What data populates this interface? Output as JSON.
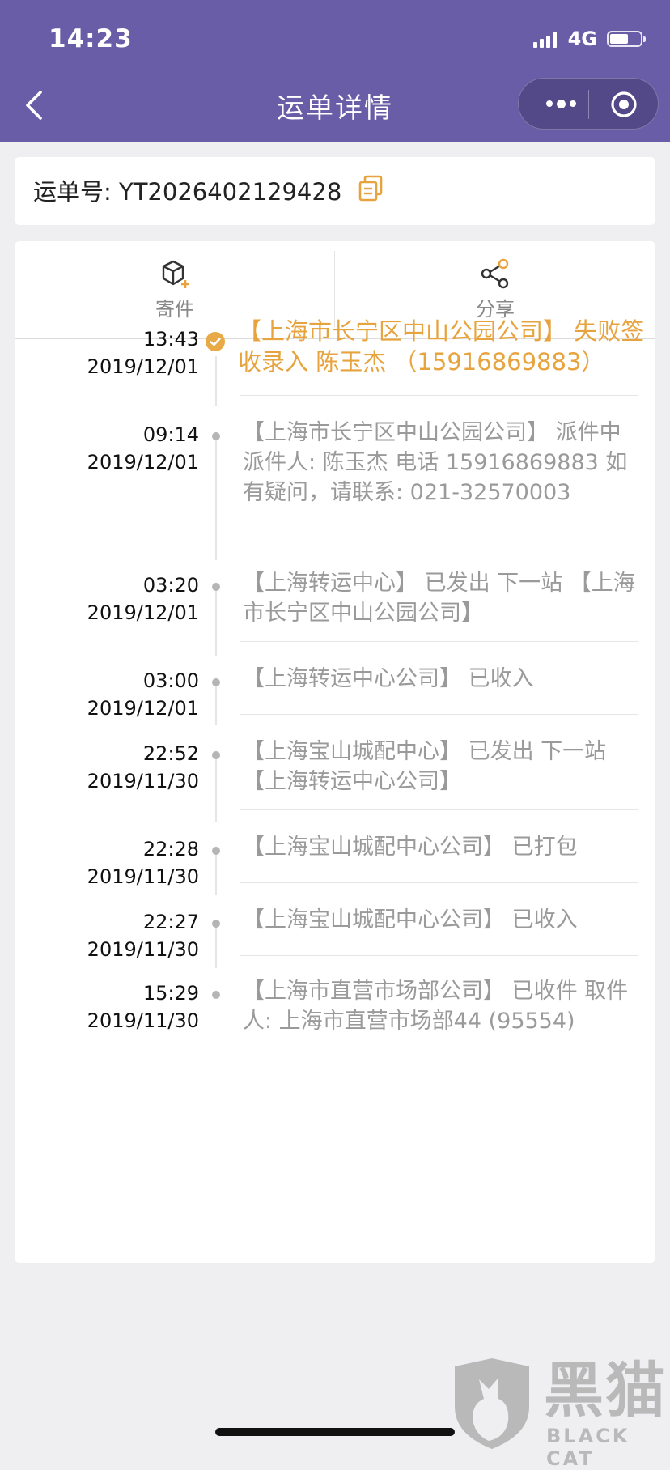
{
  "status_bar": {
    "time": "14:23",
    "network": "4G"
  },
  "nav": {
    "title": "运单详情"
  },
  "waybill": {
    "label": "运单号: YT2026402129428"
  },
  "actions": [
    {
      "label": "寄件",
      "icon": "package-add-icon"
    },
    {
      "label": "分享",
      "icon": "share-icon"
    }
  ],
  "timeline": [
    {
      "time": "13:43",
      "date": "2019/12/01",
      "text": "【上海市长宁区中山公园公司】 失败签收录入 陈玉杰 （15916869883）",
      "active": true
    },
    {
      "time": "09:14",
      "date": "2019/12/01",
      "text": "【上海市长宁区中山公园公司】 派件中 派件人: 陈玉杰 电话 15916869883 如有疑问，请联系: 021-32570003",
      "active": false
    },
    {
      "time": "03:20",
      "date": "2019/12/01",
      "text": "【上海转运中心】 已发出 下一站 【上海市长宁区中山公园公司】",
      "active": false
    },
    {
      "time": "03:00",
      "date": "2019/12/01",
      "text": "【上海转运中心公司】 已收入",
      "active": false
    },
    {
      "time": "22:52",
      "date": "2019/11/30",
      "text": "【上海宝山城配中心】 已发出 下一站 【上海转运中心公司】",
      "active": false
    },
    {
      "time": "22:28",
      "date": "2019/11/30",
      "text": "【上海宝山城配中心公司】 已打包",
      "active": false
    },
    {
      "time": "22:27",
      "date": "2019/11/30",
      "text": "【上海宝山城配中心公司】 已收入",
      "active": false
    },
    {
      "time": "15:29",
      "date": "2019/11/30",
      "text": "【上海市直营市场部公司】 已收件 取件人: 上海市直营市场部44 (95554)",
      "active": false
    }
  ],
  "watermark": {
    "text": "黑猫",
    "sub": "BLACK CAT"
  },
  "colors": {
    "header": "#6a5da7",
    "accent": "#e7a33d",
    "muted": "#9a9a9a"
  }
}
